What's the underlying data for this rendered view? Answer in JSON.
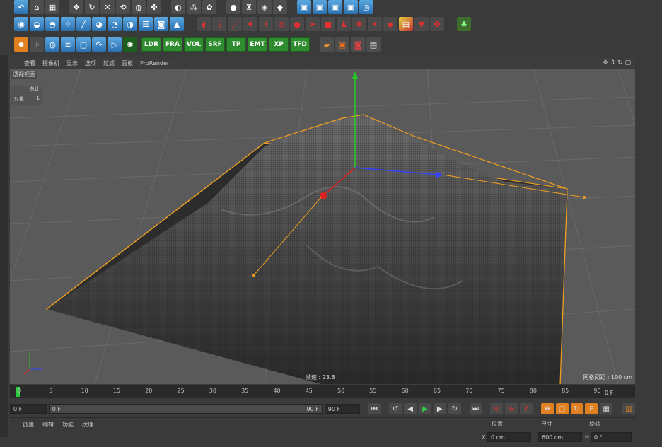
{
  "toolbar": {
    "row3_labels": [
      "LDR",
      "FRA",
      "VOL",
      "SRF",
      "TP",
      "EMT",
      "XP",
      "TFD"
    ]
  },
  "viewport_menu": [
    "查看",
    "摄像机",
    "显示",
    "选项",
    "过滤",
    "面板",
    "ProRender"
  ],
  "viewport": {
    "name": "透视视图",
    "hud_header": "总计",
    "hud_row_label": "对象",
    "hud_row_value": "1",
    "fps_label": "帧速 : 23.8",
    "grid_label": "网格间距 : 100 cm"
  },
  "timeline": {
    "ticks": [
      "0",
      "5",
      "10",
      "15",
      "20",
      "25",
      "30",
      "35",
      "40",
      "45",
      "50",
      "55",
      "60",
      "65",
      "70",
      "75",
      "80",
      "85",
      "90"
    ],
    "current_frame_right": "0 F"
  },
  "playback": {
    "start_field": "0 F",
    "range_start": "0 F",
    "range_end": "90 F",
    "end_field": "90 F"
  },
  "bottom_menu": [
    "创建",
    "编辑",
    "功能",
    "纹理"
  ],
  "coords": {
    "headers": [
      "位置",
      "尺寸",
      "旋转"
    ],
    "x_label": "X",
    "x_pos": "0 cm",
    "x_size": "600 cm",
    "h_label": "H",
    "h_rot": "0 °"
  },
  "colors": {
    "accent_green": "#2e8b2e",
    "selection_orange": "#f0a020",
    "axis_green": "#22cc22",
    "axis_red": "#dd2222",
    "axis_blue": "#3344ff"
  }
}
